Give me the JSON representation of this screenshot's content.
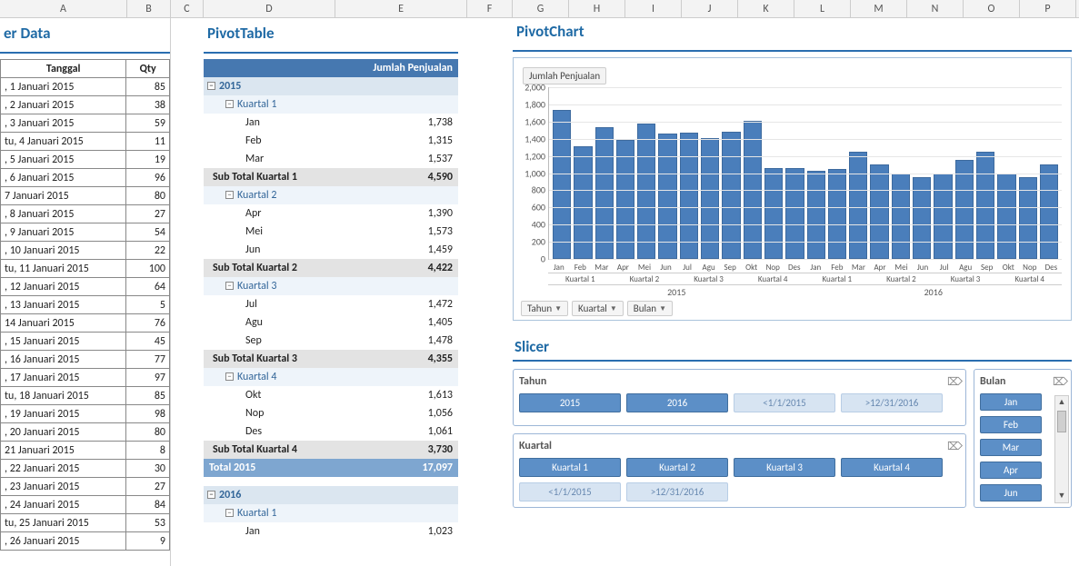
{
  "col_labels": [
    "A",
    "B",
    "C",
    "D",
    "E",
    "F",
    "G",
    "H",
    "I",
    "J",
    "K",
    "L",
    "M",
    "N",
    "O",
    "P"
  ],
  "titles": {
    "data": "er Data",
    "pivot_table": "PivotTable",
    "pivot_chart": "PivotChart",
    "slicer": "Slicer"
  },
  "data_table": {
    "headers": {
      "date": "Tanggal",
      "qty": "Qty"
    },
    "rows": [
      {
        "date": ", 1 Januari 2015",
        "qty": 85
      },
      {
        "date": ", 2 Januari 2015",
        "qty": 38
      },
      {
        "date": ", 3 Januari 2015",
        "qty": 59
      },
      {
        "date": "tu, 4 Januari 2015",
        "qty": 11
      },
      {
        "date": ", 5 Januari 2015",
        "qty": 19
      },
      {
        "date": ", 6 Januari 2015",
        "qty": 96
      },
      {
        "date": "7 Januari 2015",
        "qty": 80
      },
      {
        "date": ", 8 Januari 2015",
        "qty": 27
      },
      {
        "date": ", 9 Januari 2015",
        "qty": 54
      },
      {
        "date": ", 10 Januari 2015",
        "qty": 22
      },
      {
        "date": "tu, 11 Januari 2015",
        "qty": 100
      },
      {
        "date": ", 12 Januari 2015",
        "qty": 64
      },
      {
        "date": ", 13 Januari 2015",
        "qty": 5
      },
      {
        "date": "14 Januari 2015",
        "qty": 76
      },
      {
        "date": ", 15 Januari 2015",
        "qty": 45
      },
      {
        "date": ", 16 Januari 2015",
        "qty": 77
      },
      {
        "date": ", 17 Januari 2015",
        "qty": 97
      },
      {
        "date": "tu, 18 Januari 2015",
        "qty": 85
      },
      {
        "date": ", 19 Januari 2015",
        "qty": 98
      },
      {
        "date": ", 20 Januari 2015",
        "qty": 80
      },
      {
        "date": "21 Januari 2015",
        "qty": 8
      },
      {
        "date": ", 22 Januari 2015",
        "qty": 30
      },
      {
        "date": ", 23 Januari 2015",
        "qty": 27
      },
      {
        "date": ", 24 Januari 2015",
        "qty": 84
      },
      {
        "date": "tu, 25 Januari 2015",
        "qty": 53
      },
      {
        "date": ", 26 Januari 2015",
        "qty": 9
      }
    ]
  },
  "pivot_table": {
    "value_header": "Jumlah Penjualan",
    "years": [
      {
        "year": "2015",
        "quarters": [
          {
            "name": "Kuartal 1",
            "months": [
              {
                "m": "Jan",
                "v": "1,738"
              },
              {
                "m": "Feb",
                "v": "1,315"
              },
              {
                "m": "Mar",
                "v": "1,537"
              }
            ],
            "sub_label": "Sub Total Kuartal 1",
            "sub": "4,590"
          },
          {
            "name": "Kuartal 2",
            "months": [
              {
                "m": "Apr",
                "v": "1,390"
              },
              {
                "m": "Mei",
                "v": "1,573"
              },
              {
                "m": "Jun",
                "v": "1,459"
              }
            ],
            "sub_label": "Sub Total Kuartal 2",
            "sub": "4,422"
          },
          {
            "name": "Kuartal 3",
            "months": [
              {
                "m": "Jul",
                "v": "1,472"
              },
              {
                "m": "Agu",
                "v": "1,405"
              },
              {
                "m": "Sep",
                "v": "1,478"
              }
            ],
            "sub_label": "Sub Total Kuartal 3",
            "sub": "4,355"
          },
          {
            "name": "Kuartal 4",
            "months": [
              {
                "m": "Okt",
                "v": "1,613"
              },
              {
                "m": "Nop",
                "v": "1,056"
              },
              {
                "m": "Des",
                "v": "1,061"
              }
            ],
            "sub_label": "Sub Total Kuartal 4",
            "sub": "3,730"
          }
        ],
        "total_label": "Total 2015",
        "total": "17,097"
      },
      {
        "year": "2016",
        "quarters": [
          {
            "name": "Kuartal 1",
            "months": [
              {
                "m": "Jan",
                "v": "1,023"
              }
            ]
          }
        ]
      }
    ]
  },
  "chart_data": {
    "type": "bar",
    "title_tag": "Jumlah Penjualan",
    "ylim": [
      0,
      2000
    ],
    "yticks": [
      "0",
      "200",
      "400",
      "600",
      "800",
      "1,000",
      "1,200",
      "1,400",
      "1,600",
      "1,800",
      "2,000"
    ],
    "categories": [
      "Jan",
      "Feb",
      "Mar",
      "Apr",
      "Mei",
      "Jun",
      "Jul",
      "Agu",
      "Sep",
      "Okt",
      "Nop",
      "Des",
      "Jan",
      "Feb",
      "Mar",
      "Apr",
      "Mei",
      "Jun",
      "Jul",
      "Agu",
      "Sep",
      "Okt",
      "Nop",
      "Des"
    ],
    "values": [
      1738,
      1315,
      1537,
      1390,
      1573,
      1459,
      1472,
      1405,
      1478,
      1613,
      1056,
      1061,
      1023,
      1050,
      1250,
      1100,
      1000,
      950,
      1000,
      1150,
      1250,
      1000,
      950,
      1100
    ],
    "quarters": [
      "Kuartal 1",
      "Kuartal 2",
      "Kuartal 3",
      "Kuartal 4",
      "Kuartal 1",
      "Kuartal 2",
      "Kuartal 3",
      "Kuartal 4"
    ],
    "years": [
      "2015",
      "2016"
    ],
    "field_buttons": [
      "Tahun",
      "Kuartal",
      "Bulan"
    ]
  },
  "slicers": {
    "tahun": {
      "label": "Tahun",
      "items": [
        {
          "t": "2015",
          "dim": false
        },
        {
          "t": "2016",
          "dim": false
        },
        {
          "t": "<1/1/2015",
          "dim": true
        },
        {
          "t": ">12/31/2016",
          "dim": true
        }
      ]
    },
    "kuartal": {
      "label": "Kuartal",
      "items": [
        {
          "t": "Kuartal 1",
          "dim": false
        },
        {
          "t": "Kuartal 2",
          "dim": false
        },
        {
          "t": "Kuartal 3",
          "dim": false
        },
        {
          "t": "Kuartal 4",
          "dim": false
        },
        {
          "t": "<1/1/2015",
          "dim": true
        },
        {
          "t": ">12/31/2016",
          "dim": true
        }
      ]
    },
    "bulan": {
      "label": "Bulan",
      "items": [
        {
          "t": "Jan",
          "dim": false
        },
        {
          "t": "Feb",
          "dim": false
        },
        {
          "t": "Mar",
          "dim": false
        },
        {
          "t": "Apr",
          "dim": false
        },
        {
          "t": "Jun",
          "dim": false
        }
      ]
    }
  }
}
